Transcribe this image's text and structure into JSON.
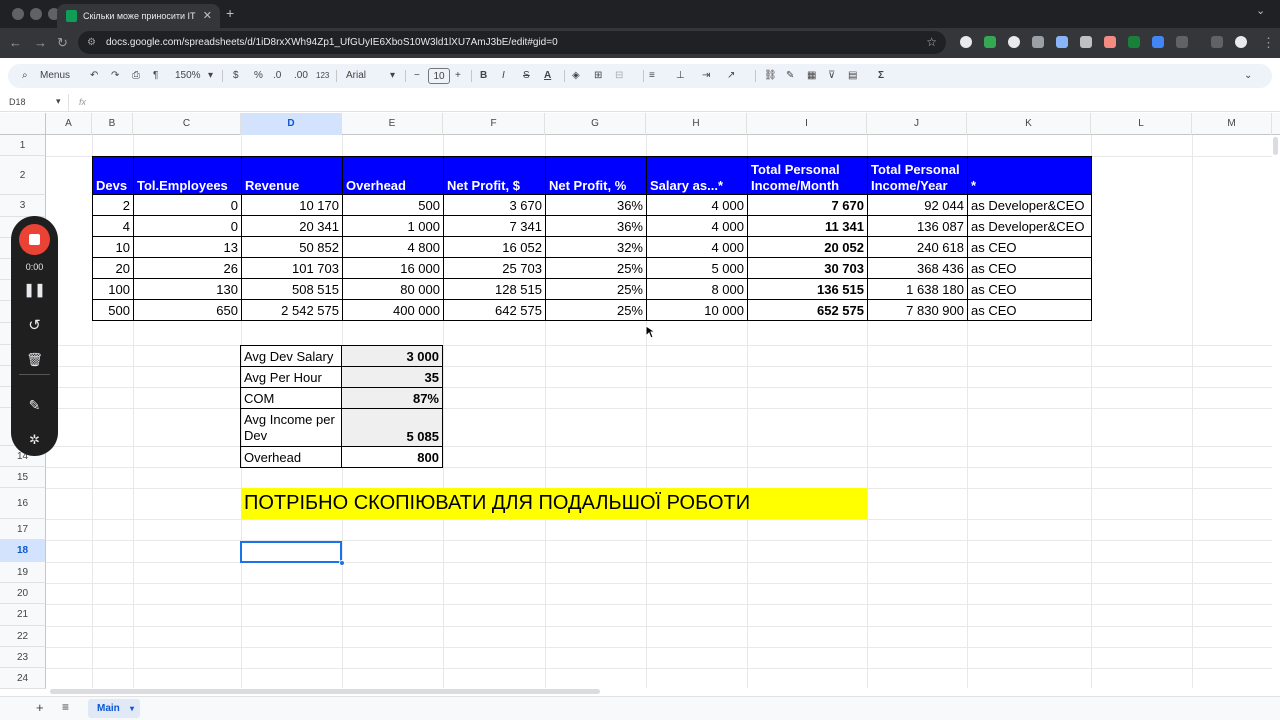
{
  "browser": {
    "tab_title": "Скільки може приносити IT",
    "url": "docs.google.com/spreadsheets/d/1iD8rxXWh94Zp1_UfGUyIE6XboS10W3ld1lXU7AmJ3bE/edit#gid=0"
  },
  "toolbar": {
    "menus_label": "Menus",
    "zoom": "150%",
    "currency": "$",
    "percent": "%",
    "dec_decrease": ".0",
    "dec_increase": ".00",
    "format_123": "123",
    "font": "Arial",
    "font_size": "10",
    "bold": "B",
    "italic": "I",
    "strike": "S",
    "textcolor": "A",
    "sigma": "Σ"
  },
  "formula_bar": {
    "cell_ref": "D18",
    "fx": "fx"
  },
  "grid": {
    "columns": [
      "A",
      "B",
      "C",
      "D",
      "E",
      "F",
      "G",
      "H",
      "I",
      "J",
      "K",
      "L",
      "M"
    ],
    "rows": [
      "1",
      "2",
      "3",
      "4",
      "5",
      "6",
      "7",
      "8",
      "9",
      "10",
      "11",
      "12",
      "13",
      "14",
      "15",
      "16",
      "17",
      "18",
      "19",
      "20",
      "21",
      "22",
      "23",
      "24"
    ],
    "selected_column": "D",
    "selected_row": "18"
  },
  "table": {
    "headers": [
      "Devs",
      "Tol.Employees",
      "Revenue",
      "Overhead",
      "Net Profit, $",
      "Net Profit, %",
      "Salary as...*",
      "Total Personal Income/Month",
      "Total Personal Income/Year",
      "*"
    ],
    "rows": [
      [
        "2",
        "0",
        "10 170",
        "500",
        "3 670",
        "36%",
        "4 000",
        "7 670",
        "92 044",
        "as Developer&CEO"
      ],
      [
        "4",
        "0",
        "20 341",
        "1 000",
        "7 341",
        "36%",
        "4 000",
        "11 341",
        "136 087",
        "as Developer&CEO"
      ],
      [
        "10",
        "13",
        "50 852",
        "4 800",
        "16 052",
        "32%",
        "4 000",
        "20 052",
        "240 618",
        "as CEO"
      ],
      [
        "20",
        "26",
        "101 703",
        "16 000",
        "25 703",
        "25%",
        "5 000",
        "30 703",
        "368 436",
        "as CEO"
      ],
      [
        "100",
        "130",
        "508 515",
        "80 000",
        "128 515",
        "25%",
        "8 000",
        "136 515",
        "1 638 180",
        "as CEO"
      ],
      [
        "500",
        "650",
        "2 542 575",
        "400 000",
        "642 575",
        "25%",
        "10 000",
        "652 575",
        "7 830 900",
        "as CEO"
      ]
    ]
  },
  "summary": {
    "rows": [
      {
        "label": "Avg Dev Salary",
        "value": "3 000"
      },
      {
        "label": "Avg Per Hour",
        "value": "35"
      },
      {
        "label": "COM",
        "value": "87%"
      },
      {
        "label": "Avg Income per Dev",
        "value": "5 085"
      },
      {
        "label": "Overhead",
        "value": "800"
      }
    ]
  },
  "banner": {
    "text": "ПОТРІБНО СКОПІЮВАТИ ДЛЯ ПОДАЛЬШОЇ РОБОТИ",
    "color": "#ffff00"
  },
  "recorder": {
    "time": "0:00"
  },
  "sheets": {
    "active": "Main"
  },
  "colors": {
    "header_bg": "#0000ff",
    "selection": "#1a73e8",
    "record": "#ea4335"
  }
}
